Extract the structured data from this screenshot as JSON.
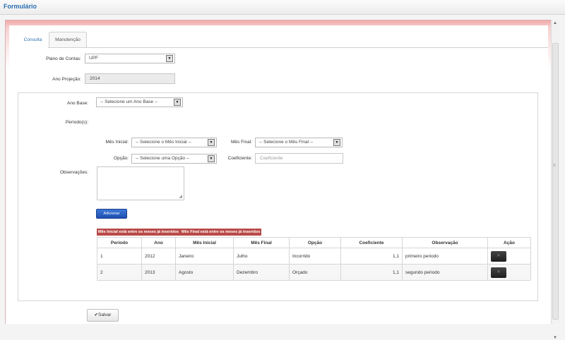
{
  "window": {
    "title": "Formulário"
  },
  "tabs": [
    {
      "label": "Consulta"
    },
    {
      "label": "Manutenção"
    }
  ],
  "form": {
    "plano_label": "Plano de Contas:",
    "plano_value": "UPF",
    "ano_proj_label": "Ano Projeção:",
    "ano_proj_value": "2014"
  },
  "periodo": {
    "ano_base_label": "Ano Base:",
    "ano_base_value": "-- Selecione um Ano Base --",
    "periodos_label": "Período(s):",
    "mes_inicial_label": "Mês Inicial:",
    "mes_inicial_value": "-- Selecione o Mês Inicial --",
    "mes_final_label": "Mês Final:",
    "mes_final_value": "-- Selecione o Mês Final --",
    "opcao_label": "Opção:",
    "opcao_value": "-- Selecione uma Opção --",
    "coeficiente_label": "Coeficiente:",
    "coeficiente_placeholder": "Coeficiente",
    "observacoes_label": "Observações:",
    "add_button": "Adicionar"
  },
  "errors": [
    "Mês Inicial está entre os meses já inseridos",
    "Mês Final está entre os meses já inseridos"
  ],
  "table": {
    "headers": [
      "Período",
      "Ano",
      "Mês Inicial",
      "Mês Final",
      "Opção",
      "Coeficiente",
      "Observação",
      "Ação"
    ],
    "rows": [
      [
        "1",
        "2012",
        "Janeiro",
        "Julho",
        "Incorrido",
        "1,1",
        "primeiro periodo"
      ],
      [
        "2",
        "2013",
        "Agosto",
        "Dezembro",
        "Orçado",
        "1,1",
        "segundo periodo"
      ]
    ]
  },
  "footer": {
    "save_label": "Salvar"
  },
  "icons": {
    "dropdown": "dropdown-arrow-icon",
    "check": "check-icon",
    "resize": "resize-grip-icon"
  },
  "colors": {
    "title": "#2a6fb0",
    "primary_button": "#1d4fb0",
    "error_badge": "#b94a48",
    "header_accent": "#f1a9a9"
  }
}
